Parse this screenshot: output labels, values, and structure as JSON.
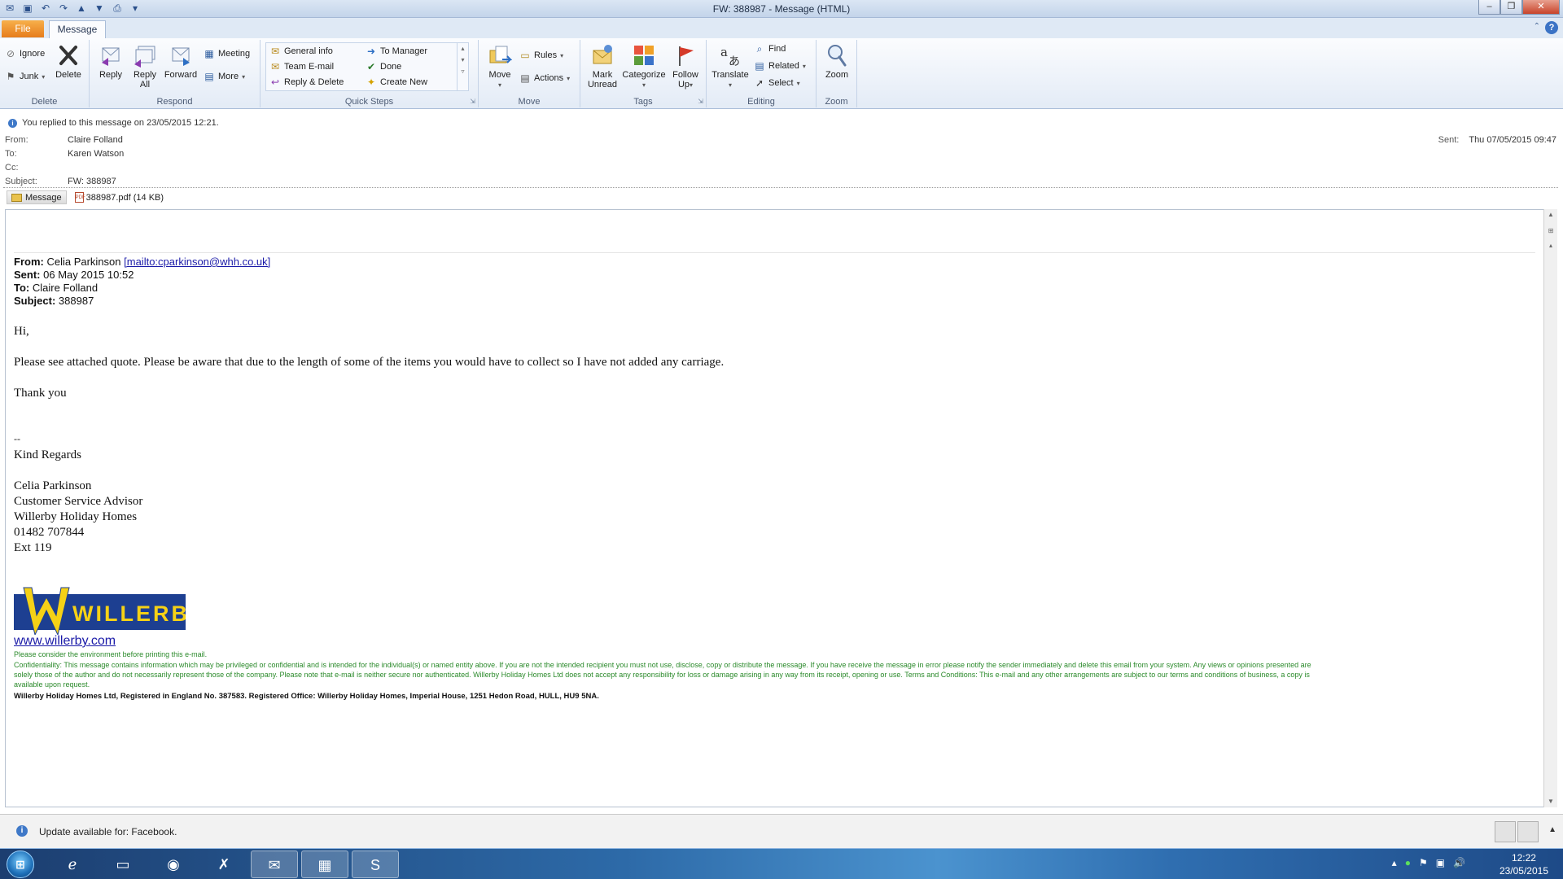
{
  "window": {
    "title": "FW: 388987  -  Message (HTML)"
  },
  "ribbon": {
    "tabs": {
      "file": "File",
      "message": "Message"
    },
    "delete_group": {
      "label": "Delete",
      "ignore": "Ignore",
      "junk": "Junk",
      "delete": "Delete"
    },
    "respond_group": {
      "label": "Respond",
      "reply": "Reply",
      "reply_all": "Reply All",
      "forward": "Forward",
      "meeting": "Meeting",
      "more": "More"
    },
    "quick_steps": {
      "label": "Quick Steps",
      "general_info": "General info",
      "team_email": "Team E-mail",
      "reply_delete": "Reply & Delete",
      "to_manager": "To Manager",
      "done": "Done",
      "create_new": "Create New"
    },
    "move_group": {
      "label": "Move",
      "move": "Move",
      "rules": "Rules",
      "actions": "Actions"
    },
    "tags_group": {
      "label": "Tags",
      "mark_unread": "Mark Unread",
      "categorize": "Categorize",
      "follow_up": "Follow Up"
    },
    "editing_group": {
      "label": "Editing",
      "translate": "Translate",
      "find": "Find",
      "related": "Related",
      "select": "Select"
    },
    "zoom_group": {
      "label": "Zoom",
      "zoom": "Zoom"
    }
  },
  "header": {
    "info": "You replied to this message on 23/05/2015 12:21.",
    "from_label": "From:",
    "from": "Claire Folland",
    "to_label": "To:",
    "to": "Karen Watson",
    "cc_label": "Cc:",
    "cc": "",
    "subject_label": "Subject:",
    "subject": "FW: 388987",
    "sent_label": "Sent:",
    "sent": "Thu 07/05/2015 09:47",
    "message_tab": "Message",
    "attachment": "388987.pdf (14 KB)"
  },
  "body": {
    "fwd_from_label": "From:",
    "fwd_from": "Celia Parkinson",
    "fwd_mailto": "[mailto:cparkinson@whh.co.uk]",
    "fwd_sent_label": "Sent:",
    "fwd_sent": "06 May 2015 10:52",
    "fwd_to_label": "To:",
    "fwd_to": "Claire Folland",
    "fwd_subject_label": "Subject:",
    "fwd_subject": "388987",
    "greeting": "Hi,",
    "paragraph": "Please see attached quote. Please be aware that due to the length of some of the items you would have to collect so I have not added any carriage.",
    "thanks": "Thank you",
    "sig_dashes": "--",
    "regards": "Kind Regards",
    "sig_name": "Celia Parkinson",
    "sig_role": "Customer Service Advisor",
    "sig_company": "Willerby Holiday Homes",
    "sig_phone": "01482 707844",
    "sig_ext": "Ext 119",
    "logo_text": "WILLERBY",
    "website": "www.willerby.com",
    "env_note": "Please consider the environment before printing this e-mail.",
    "confidentiality_1": "Confidentiality: This message contains information which may be privileged or confidential and is intended for the individual(s) or named entity above. If you are not the intended recipient you must not use, disclose, copy or distribute the message. If you have receive the message in error please notify the sender immediately and delete this email from your system. Any views or opinions presented are",
    "confidentiality_2": "solely those of the author and do not necessarily represent those of the company. Please note that e-mail is neither secure nor authenticated. Willerby Holiday Homes Ltd does not accept any responsibility for loss or damage arising in any way from its receipt, opening or use. Terms and Conditions: This e-mail and any other arrangements are subject to our terms and conditions of business, a copy is",
    "confidentiality_3": "available upon request.",
    "registered": "Willerby Holiday Homes Ltd, Registered in England No. 387583. Registered Office: Willerby Holiday Homes, Imperial House, 1251 Hedon Road, HULL, HU9 5NA."
  },
  "statusbar": {
    "text": "Update available for: Facebook."
  },
  "taskbar": {
    "time": "12:22",
    "date": "23/05/2015",
    "apps": [
      "internet-explorer-icon",
      "file-explorer-icon",
      "chrome-icon",
      "app-x-icon",
      "outlook-icon",
      "calculator-icon",
      "sage-icon"
    ]
  },
  "colors": {
    "file_tab": "#e67c1b",
    "link": "#1a1aa8",
    "disclaimer_green": "#2b8a2b",
    "logo_blue": "#1d3f91",
    "logo_yellow": "#f5d116"
  }
}
